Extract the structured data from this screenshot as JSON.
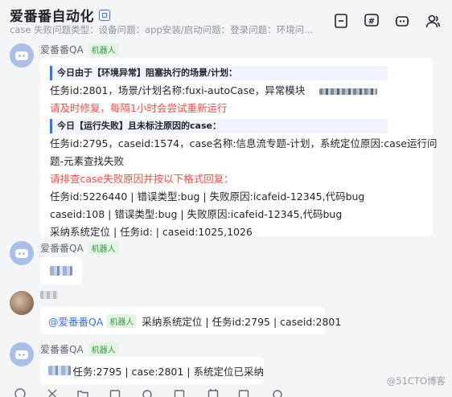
{
  "header": {
    "title": "爱番番自动化",
    "subtitle": "case 失败问题类型：设备问题：app安装/启动问题：登录问题：环境问..."
  },
  "messages": {
    "m1": {
      "sender": "爱番番QA",
      "tag": "机器人",
      "heading1": "今日由于【环境异常】阻塞执行的场景/计划：",
      "line1": "任务id:2801，场景/计划名称:fuxi-autoCase，异常模块",
      "line2": "请及时修复，每隔1小时会尝试重新运行",
      "heading2": "今日【运行失败】且未标注原因的case：",
      "line3": "任务id:2795，caseid:1574，case名称:信息流专题-计划，系统定位原因:case运行问",
      "line4": "题-元素查找失败",
      "line5": "请排查case失败原因并按以下格式回复：",
      "line6": "任务id:5226440 | 错误类型:bug | 失败原因:icafeid-12345,代码bug",
      "line7": "caseid:108 | 错误类型:bug | 失败原因:icafeid-12345,代码bug",
      "line8": "采纳系统定位 | 任务id: | caseid:1025,1026"
    },
    "m2": {
      "sender": "爱番番QA",
      "tag": "机器人"
    },
    "m3": {
      "mention": "@爱番番QA",
      "tag": "机器人",
      "text": "采纳系统定位 | 任务id:2795 | caseid:2801"
    },
    "m4": {
      "sender": "爱番番QA",
      "tag": "机器人",
      "text": "任务:2795 | case:2801 | 系统定位已采纳"
    }
  },
  "watermark": "@51CTO博客"
}
